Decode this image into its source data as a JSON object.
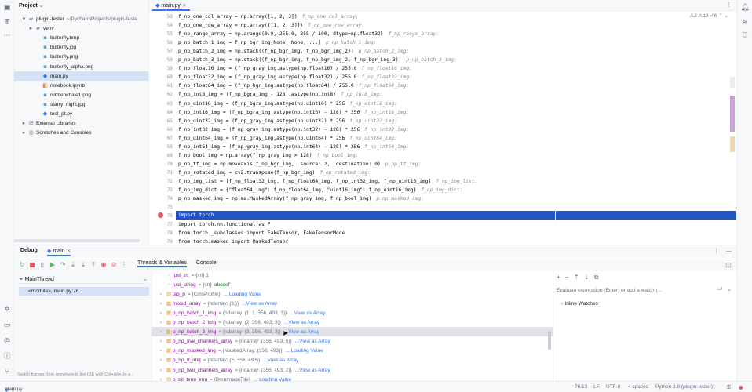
{
  "project": {
    "header": "Project",
    "items": [
      {
        "label": "plugin-tester",
        "path": "~/PycharmProjects/plugin-teste",
        "icon": "folder-icon",
        "indent": 0,
        "arrow": "▾"
      },
      {
        "label": "venv",
        "path": "",
        "icon": "folder-icon",
        "indent": 1,
        "arrow": "▸"
      },
      {
        "label": "butterfly.bmp",
        "path": "",
        "icon": "image-file-icon",
        "indent": 2,
        "arrow": ""
      },
      {
        "label": "butterfly.jpg",
        "path": "",
        "icon": "image-file-icon",
        "indent": 2,
        "arrow": ""
      },
      {
        "label": "butterfly.png",
        "path": "",
        "icon": "image-file-icon",
        "indent": 2,
        "arrow": ""
      },
      {
        "label": "butterfly_alpha.png",
        "path": "",
        "icon": "image-file-icon",
        "indent": 2,
        "arrow": ""
      },
      {
        "label": "main.py",
        "path": "",
        "icon": "python-file-icon",
        "indent": 2,
        "arrow": "",
        "selected": true
      },
      {
        "label": "notebook.ipynb",
        "path": "",
        "icon": "notebook-file-icon",
        "indent": 2,
        "arrow": ""
      },
      {
        "label": "rubberwhale1.png",
        "path": "",
        "icon": "image-file-icon",
        "indent": 2,
        "arrow": ""
      },
      {
        "label": "starry_night.jpg",
        "path": "",
        "icon": "image-file-icon",
        "indent": 2,
        "arrow": ""
      },
      {
        "label": "test_pt.py",
        "path": "",
        "icon": "python-file-icon",
        "indent": 2,
        "arrow": ""
      },
      {
        "label": "External Libraries",
        "path": "",
        "icon": "library-icon",
        "indent": 0,
        "arrow": "▸"
      },
      {
        "label": "Scratches and Consoles",
        "path": "",
        "icon": "scratches-icon",
        "indent": 0,
        "arrow": "▸"
      }
    ]
  },
  "editor": {
    "tab_label": "main.py",
    "status": "⚠2  ⚠19  ✓6",
    "lines": [
      {
        "n": "53",
        "code": "f_np_one_col_array = np.array([1, 2, 3])",
        "hint": "f_np_one_col_array:"
      },
      {
        "n": "54",
        "code": "f_np_one_row_array = np.array([[1, 2, 3]])",
        "hint": "f_np_one_row_array:"
      },
      {
        "n": "55",
        "code": "f_np_range_array = np.arange(0.0, 255.0, 255 / 100, dtype=np.float32)",
        "hint": "f_np_range_array:"
      },
      {
        "n": "56",
        "code": "p_np_batch_1_img = f_np_bgr_img[None, None, ...]",
        "hint": "p_np_batch_1_img:"
      },
      {
        "n": "57",
        "code": "p_np_batch_2_img = np.stack((f_np_bgr_img, f_np_bgr_img_2))",
        "hint": "p_np_batch_2_img:"
      },
      {
        "n": "58",
        "code": "p_np_batch_3_img = np.stack((f_np_bgr_img, f_np_bgr_img_2, f_np_bgr_img_3))",
        "hint": "p_np_batch_3_img:"
      },
      {
        "n": "59",
        "code": "f_np_float16_img = (f_np_gray_img.astype(np.float16) / 255.0",
        "hint": "f_np_float16_img:"
      },
      {
        "n": "60",
        "code": "f_np_float32_img = (f_np_gray_img.astype(np.float32) / 255.0",
        "hint": "f_np_float32_img:"
      },
      {
        "n": "61",
        "code": "f_np_float64_img = (f_np_bgr_img.astype(np.float64) / 255.0",
        "hint": "f_np_float64_img:"
      },
      {
        "n": "62",
        "code": "f_np_int8_img = (f_np_bgra_img - 128).astype(np.int8)",
        "hint": "f_np_int8_img:"
      },
      {
        "n": "63",
        "code": "f_np_uint16_img = (f_np_bgra_img.astype(np.uint16) * 256",
        "hint": "f_np_uint16_img:"
      },
      {
        "n": "64",
        "code": "f_np_int16_img = (f_np_bgra_img.astype(np.int16) - 128) * 256",
        "hint": "f_np_int16_img:"
      },
      {
        "n": "65",
        "code": "f_np_uint32_img = (f_np_gray_img.astype(np.uint32) * 256",
        "hint": "f_np_uint32_img:"
      },
      {
        "n": "66",
        "code": "f_np_int32_img = (f_np_gray_img.astype(np.int32) - 128) * 256",
        "hint": "f_np_int32_img:"
      },
      {
        "n": "67",
        "code": "f_np_uint64_img = (f_np_gray_img.astype(np.uint64) * 256",
        "hint": "f_np_uint64_img:"
      },
      {
        "n": "68",
        "code": "f_np_int64_img = (f_np_gray_img.astype(np.int64) - 128) * 256",
        "hint": "f_np_int64_img:"
      },
      {
        "n": "69",
        "code": "f_np_bool_img = np.array(f_np_gray_img > 128)",
        "hint": "f_np_bool_img:"
      },
      {
        "n": "70",
        "code": "p_np_tf_img = np.moveaxis(f_np_bgr_img,  source: 2,  destination: 0)",
        "hint": "p_np_tf_img:"
      },
      {
        "n": "71",
        "code": "f_np_rotated_img = cv2.transpose(f_np_bgr_img)",
        "hint": "f_np_rotated_img:"
      },
      {
        "n": "72",
        "code": "f_np_img_list = [f_np_float32_img, f_np_float64_img, f_np_int32_img, f_np_uint16_img]",
        "hint": "f_np_img_list:"
      },
      {
        "n": "73",
        "code": "f_np_img_dict = {\"float64_img\": f_np_float64_img, \"uint16_img\": f_np_uint16_img}",
        "hint": "f_np_img_dict:"
      },
      {
        "n": "74",
        "code": "p_np_masked_img = np.ma.MaskedArray(f_np_gray_img, f_np_bool_img)",
        "hint": "p_np_masked_img:"
      },
      {
        "n": "75",
        "code": "",
        "hint": ""
      },
      {
        "n": "76",
        "code": "import torch",
        "hint": ""
      },
      {
        "n": "77",
        "code": "import torch.nn.functional as F",
        "hint": ""
      },
      {
        "n": "78",
        "code": "from torch._subclasses import FakeTensor, FakeTensorMode",
        "hint": ""
      },
      {
        "n": "79",
        "code": "from torch.masked import MaskedTensor",
        "hint": ""
      }
    ]
  },
  "debug": {
    "title": "Debug",
    "session_tab": "main",
    "tabs": [
      "Threads & Variables",
      "Console"
    ],
    "thread": "MainThread",
    "frame": "<module>, main.py:76",
    "frames_hint": "Switch frames from anywhere in the IDE with Ctrl+Alt+Up a...",
    "variables": [
      {
        "name": "just_int",
        "type": "= {int} 1",
        "value": "",
        "link": "",
        "expandable": false,
        "icon": "int-var-icon"
      },
      {
        "name": "just_string",
        "type": "= {str} ",
        "value": "'abcdef'",
        "link": "",
        "expandable": false,
        "icon": "str-var-icon"
      },
      {
        "name": "lab_p",
        "type": "= {CmsProfile}",
        "value": "",
        "link": "... Loading Value",
        "expandable": true,
        "icon": "var-icon"
      },
      {
        "name": "mixed_array",
        "type": "= {ndarray: (3,)}",
        "value": "",
        "link": "...View as Array",
        "expandable": true,
        "icon": "array-var-icon"
      },
      {
        "name": "p_np_batch_1_img",
        "type": "= {ndarray: (1, 1, 356, 493, 3)}",
        "value": "",
        "link": "...View as Array",
        "expandable": true,
        "icon": "array-var-icon"
      },
      {
        "name": "p_np_batch_2_img",
        "type": "= {ndarray: (2, 356, 493, 3)}",
        "value": "",
        "link": "...View as Array",
        "expandable": true,
        "icon": "array-var-icon"
      },
      {
        "name": "p_np_batch_3_img",
        "type": "= {ndarray: (3, 356, 493, 3)}",
        "value": "",
        "link": "...View as Array",
        "expandable": true,
        "icon": "array-var-icon",
        "selected": true
      },
      {
        "name": "p_np_five_channels_array",
        "type": "= {ndarray: (356, 493, 5)}",
        "value": "",
        "link": "...View as Array",
        "expandable": true,
        "icon": "array-var-icon"
      },
      {
        "name": "p_np_masked_img",
        "type": "= {MaskedArray: (356, 493)}",
        "value": "",
        "link": "... Loading Value",
        "expandable": true,
        "icon": "array-var-icon"
      },
      {
        "name": "p_np_tf_img",
        "type": "= {ndarray: (3, 356, 493)}",
        "value": "",
        "link": "...View as Array",
        "expandable": true,
        "icon": "array-var-icon"
      },
      {
        "name": "p_np_two_channels_array",
        "type": "= {ndarray: (356, 493, 2)}",
        "value": "",
        "link": "...View as Array",
        "expandable": true,
        "icon": "array-var-icon"
      },
      {
        "name": "p_pil_bmp_img",
        "type": "= {BmpImageFile}",
        "value": "",
        "link": "... Loading Value",
        "expandable": true,
        "icon": "var-icon"
      }
    ],
    "watch_placeholder": "Evaluate expression (Enter) or add a watch (...",
    "inline_watches": "Inline Watches"
  },
  "status_bar": {
    "breadcrumb_project": "plugin-tester",
    "breadcrumb_file": "main.py",
    "position": "76:13",
    "line_ending": "LF",
    "encoding": "UTF-8",
    "indent": "4 spaces",
    "interpreter": "Python 3.8 (plugin-tester)"
  },
  "colors": {
    "accent": "#3574f0",
    "selection": "#2154c4",
    "breakpoint": "#db5c5c"
  }
}
